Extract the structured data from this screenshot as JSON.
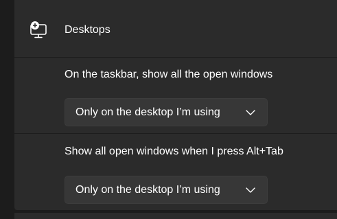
{
  "header": {
    "icon": "desktop-add-icon",
    "title": "Desktops"
  },
  "taskbar_setting": {
    "label": "On the taskbar, show all the open windows",
    "selected": "Only on the desktop I’m using"
  },
  "alttab_setting": {
    "label": "Show all open windows when I press Alt+Tab",
    "selected": "Only on the desktop I’m using"
  }
}
